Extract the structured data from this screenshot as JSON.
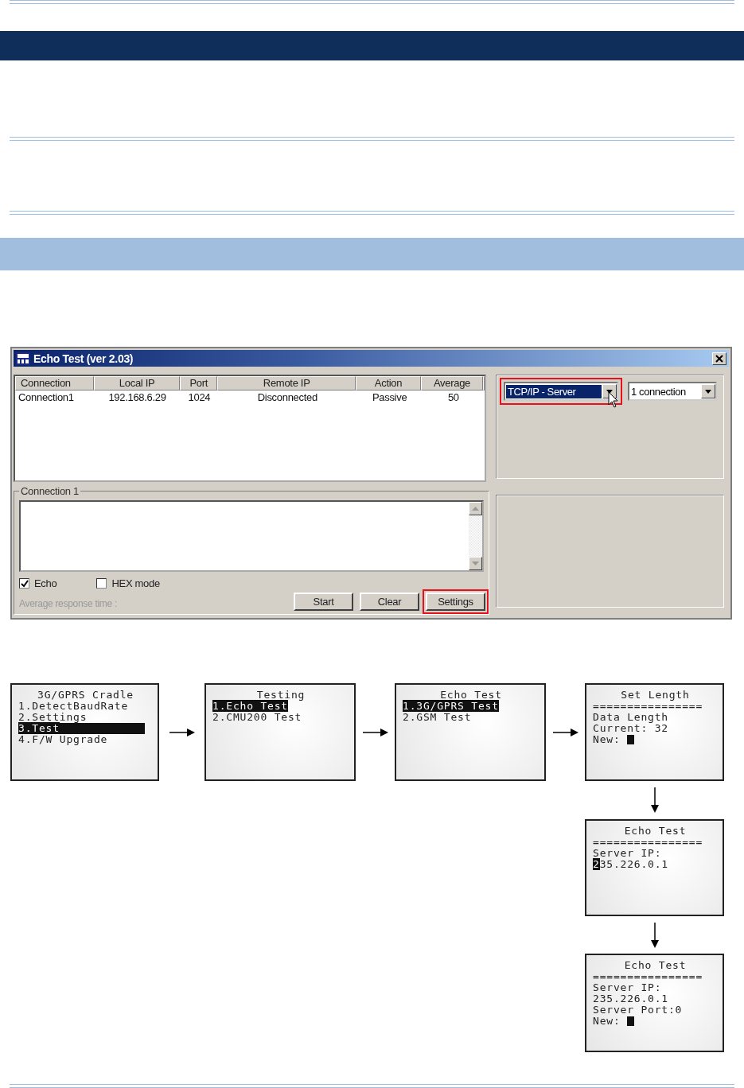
{
  "window": {
    "title": "Echo Test (ver 2.03)",
    "table": {
      "columns": [
        "Connection",
        "Local IP",
        "Port",
        "Remote IP",
        "Action",
        "Average"
      ],
      "rows": [
        [
          "Connection1",
          "192.168.6.29",
          "1024",
          "Disconnected",
          "Passive",
          "50"
        ]
      ]
    },
    "mode_select": {
      "value": "TCP/IP - Server",
      "highlighted": true
    },
    "count_select": {
      "value": "1 connection",
      "highlighted": false
    },
    "group_title": "Connection 1",
    "checkboxes": [
      {
        "label": "Echo",
        "checked": true
      },
      {
        "label": "HEX mode",
        "checked": false
      }
    ],
    "status_text": "Average response time :",
    "buttons": [
      {
        "label": "Start",
        "highlighted": false
      },
      {
        "label": "Clear",
        "highlighted": false
      },
      {
        "label": "Settings",
        "highlighted": true
      }
    ]
  },
  "screens": [
    {
      "title": "3G/GPRS Cradle",
      "lines": [
        {
          "segments": [
            {
              "text": "1.DetectBaudRate",
              "inverse": false
            }
          ],
          "cursor": false
        },
        {
          "segments": [
            {
              "text": "2.Settings",
              "inverse": false
            }
          ],
          "cursor": false
        },
        {
          "segments": [
            {
              "text": "3.Test",
              "inverse": true
            }
          ],
          "cursor": false,
          "full": true
        },
        {
          "segments": [
            {
              "text": "4.F/W Upgrade",
              "inverse": false
            }
          ],
          "cursor": false
        }
      ]
    },
    {
      "title": "Testing",
      "lines": [
        {
          "segments": [
            {
              "text": "1.Echo Test",
              "inverse": true
            }
          ],
          "cursor": false
        },
        {
          "segments": [
            {
              "text": "2.CMU200 Test",
              "inverse": false
            }
          ],
          "cursor": false
        }
      ]
    },
    {
      "title": "Echo Test",
      "lines": [
        {
          "segments": [
            {
              "text": "1.3G/GPRS Test",
              "inverse": true
            }
          ],
          "cursor": false
        },
        {
          "segments": [
            {
              "text": "2.GSM Test",
              "inverse": false
            }
          ],
          "cursor": false
        }
      ]
    },
    {
      "title": "Set Length",
      "lines": [
        {
          "segments": [
            {
              "text": "================",
              "inverse": false
            }
          ],
          "cursor": false
        },
        {
          "segments": [
            {
              "text": "Data Length",
              "inverse": false
            }
          ],
          "cursor": false
        },
        {
          "segments": [
            {
              "text": "Current: 32",
              "inverse": false
            }
          ],
          "cursor": false
        },
        {
          "segments": [
            {
              "text": "New: ",
              "inverse": false
            }
          ],
          "cursor": true
        }
      ]
    },
    {
      "title": "Echo Test",
      "lines": [
        {
          "segments": [
            {
              "text": "================",
              "inverse": false
            }
          ],
          "cursor": false
        },
        {
          "segments": [
            {
              "text": "Server IP:",
              "inverse": false
            }
          ],
          "cursor": false
        },
        {
          "segments": [
            {
              "text": "2",
              "inverse": true
            },
            {
              "text": "35.226.0.1",
              "inverse": false
            }
          ],
          "cursor": false
        }
      ]
    },
    {
      "title": "Echo Test",
      "lines": [
        {
          "segments": [
            {
              "text": "================",
              "inverse": false
            }
          ],
          "cursor": false
        },
        {
          "segments": [
            {
              "text": "Server IP:",
              "inverse": false
            }
          ],
          "cursor": false
        },
        {
          "segments": [
            {
              "text": "235.226.0.1",
              "inverse": false
            }
          ],
          "cursor": false
        },
        {
          "segments": [
            {
              "text": "Server Port:0",
              "inverse": false
            }
          ],
          "cursor": false
        },
        {
          "segments": [
            {
              "text": "New: ",
              "inverse": false
            }
          ],
          "cursor": true
        }
      ]
    }
  ]
}
